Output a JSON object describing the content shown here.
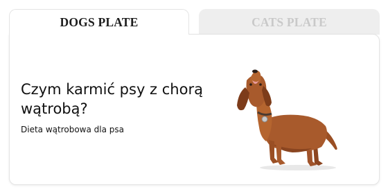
{
  "tabs": [
    {
      "label": "DOGS PLATE",
      "active": true
    },
    {
      "label": "CATS PLATE",
      "active": false
    }
  ],
  "card": {
    "headline": " Czym karmić psy z chorą wątrobą?",
    "link": "Dieta wątrobowa dla psa",
    "image_subject": "dachshund-dog"
  },
  "colors": {
    "active_tab_text": "#1d1d1d",
    "inactive_tab_bg": "#eeeeee",
    "inactive_tab_text": "#c9c9c9",
    "dog_fur": "#a85a2c"
  }
}
